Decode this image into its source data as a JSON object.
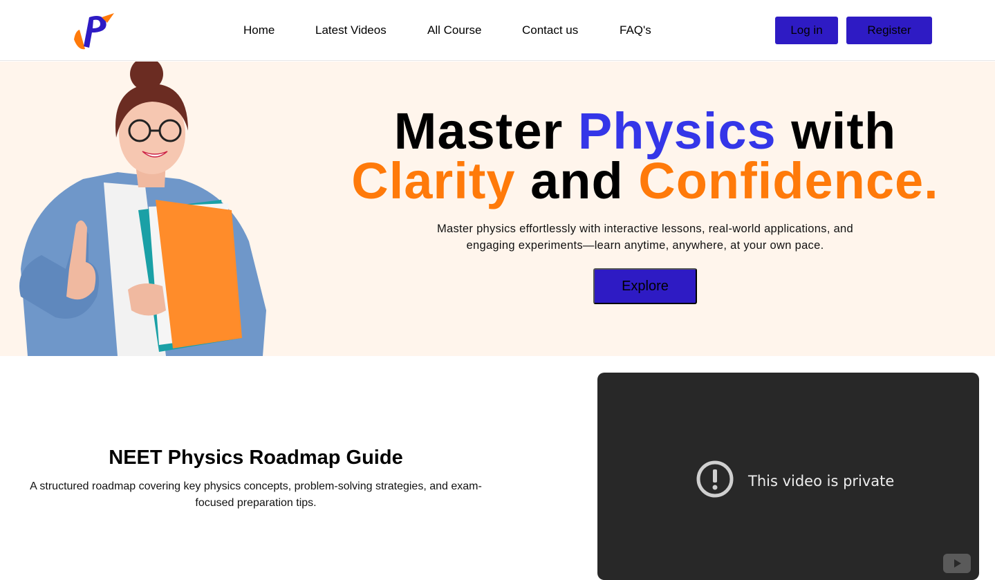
{
  "header": {
    "logo_text": "P",
    "nav": [
      "Home",
      "Latest Videos",
      "All Course",
      "Contact us",
      "FAQ's"
    ],
    "login_label": "Log in",
    "register_label": "Register"
  },
  "hero": {
    "title_parts": {
      "w1": "Master",
      "w2": "Physics",
      "w3": "with",
      "w4": "Clarity",
      "w5": "and",
      "w6": "Confidence."
    },
    "subtitle": "Master physics effortlessly with interactive lessons, real-world applications, and engaging experiments—learn anytime, anywhere, at your own pace.",
    "cta_label": "Explore"
  },
  "roadmap": {
    "title": "NEET Physics Roadmap Guide",
    "description": "A structured roadmap covering key physics concepts, problem-solving strategies, and exam-focused preparation tips."
  },
  "video": {
    "message": "This video is private",
    "icons": [
      "alert-icon",
      "youtube-icon"
    ]
  },
  "colors": {
    "primary_button": "#2e1bc4",
    "hero_bg": "#fff5ec",
    "accent_blue": "#3436e8",
    "accent_orange": "#ff7a0a",
    "video_bg": "#282828"
  }
}
